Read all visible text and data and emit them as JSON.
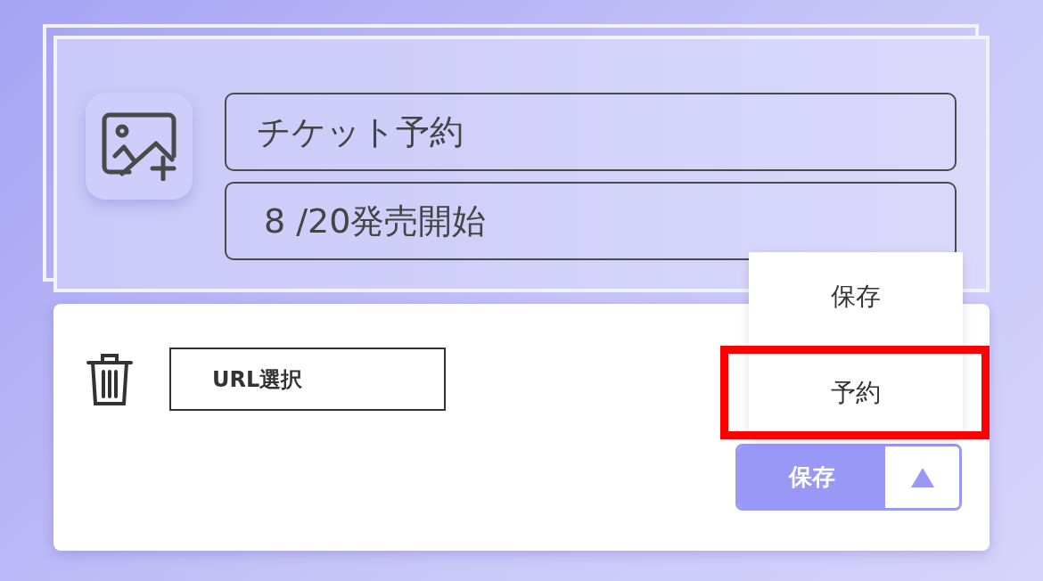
{
  "header": {
    "fields": [
      {
        "value": "チケット予約"
      },
      {
        "value": "8 /20発売開始"
      }
    ]
  },
  "url_field": {
    "label": "URL選択"
  },
  "split_button": {
    "label": "保存",
    "expanded": true
  },
  "menu": {
    "items": [
      {
        "label": "保存",
        "highlighted": false
      },
      {
        "label": "予約",
        "highlighted": true
      }
    ]
  }
}
